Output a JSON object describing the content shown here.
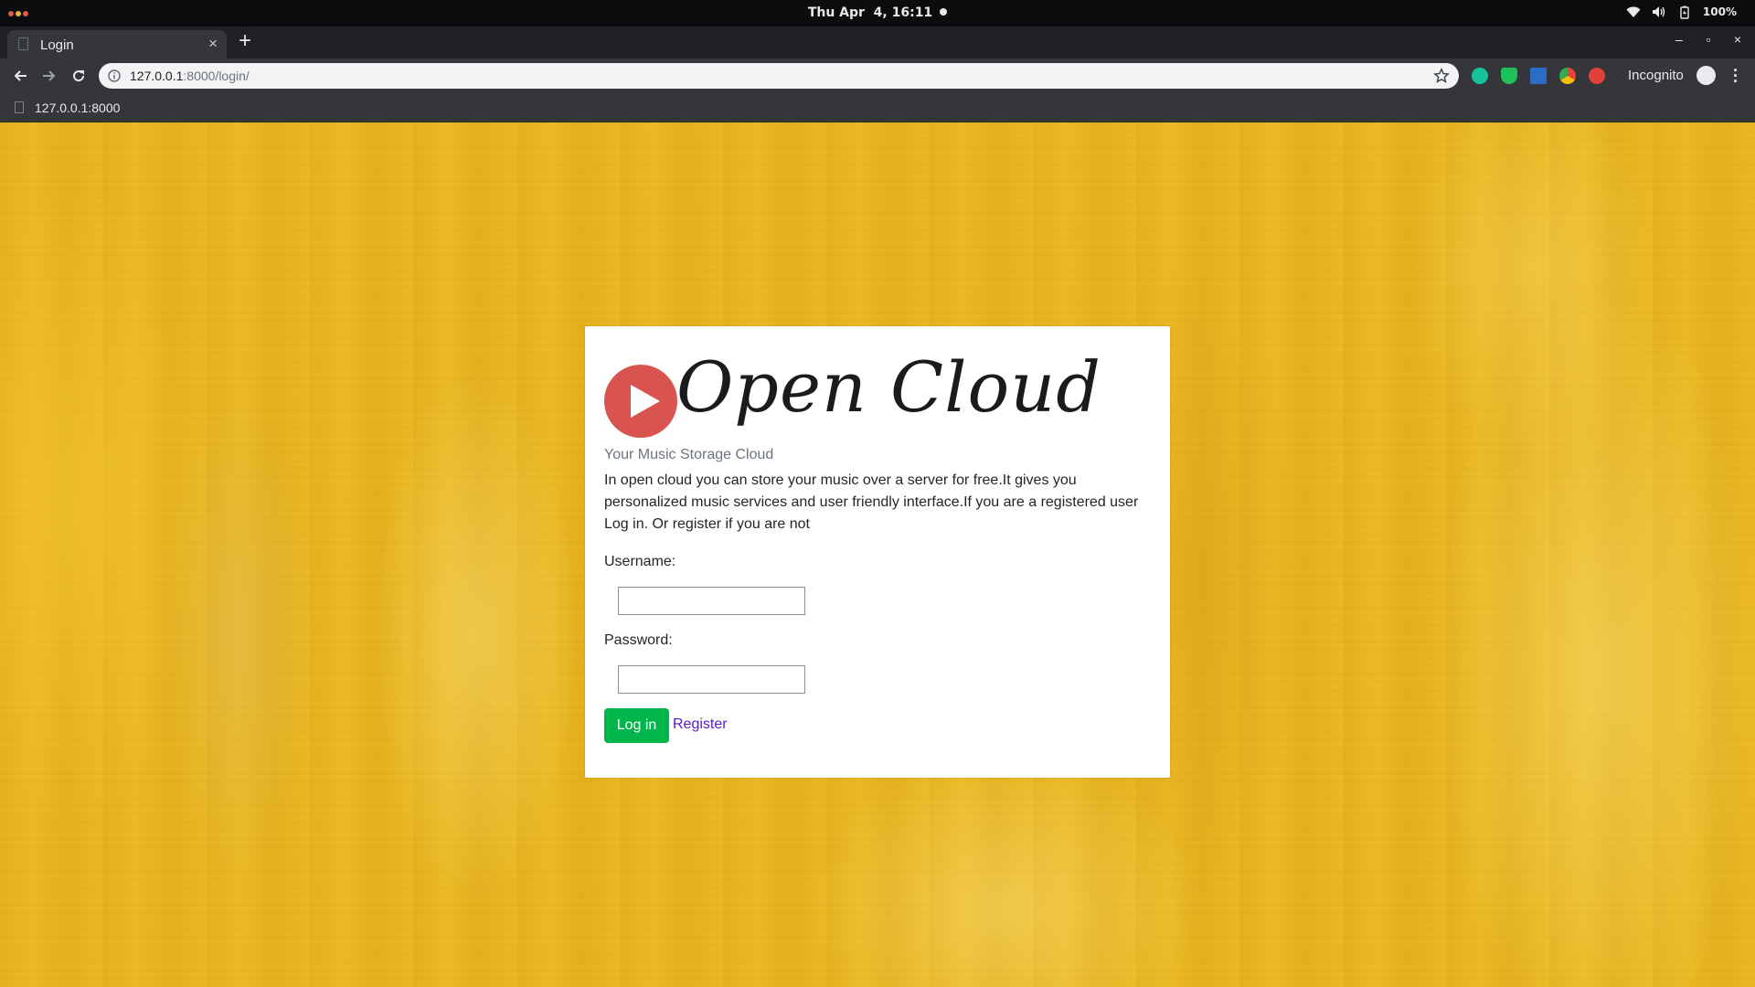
{
  "os": {
    "clock": "Thu Apr  4, 16:11",
    "battery": "100%"
  },
  "browser": {
    "tab_title": "Login",
    "tab_close": "×",
    "new_tab": "+",
    "window_controls": [
      "–",
      "▫",
      "×"
    ],
    "url_host": "127.0.0.1",
    "url_path": ":8000/login/",
    "profile_label": "Incognito",
    "bookmark_label": "127.0.0.1:8000",
    "extension_icons": [
      "grammarly-icon",
      "shield-icon",
      "flag-icon",
      "chrome-extension-icon",
      "red-extension-icon"
    ]
  },
  "page": {
    "logo_text": "Open Cloud",
    "tagline": "Your Music Storage Cloud",
    "description": "In open cloud you can store your music over a server for free.It gives you personalized music services and user friendly interface.If you are a registered user Log in. Or register if you are not",
    "username_label": "Username:",
    "username_value": "",
    "password_label": "Password:",
    "password_value": "",
    "login_button": "Log in",
    "register_link": "Register"
  },
  "colors": {
    "page_background": "#e9b620",
    "logo_accent": "#d9534f",
    "login_button": "#00b64c",
    "register_link": "#5a18c8"
  }
}
